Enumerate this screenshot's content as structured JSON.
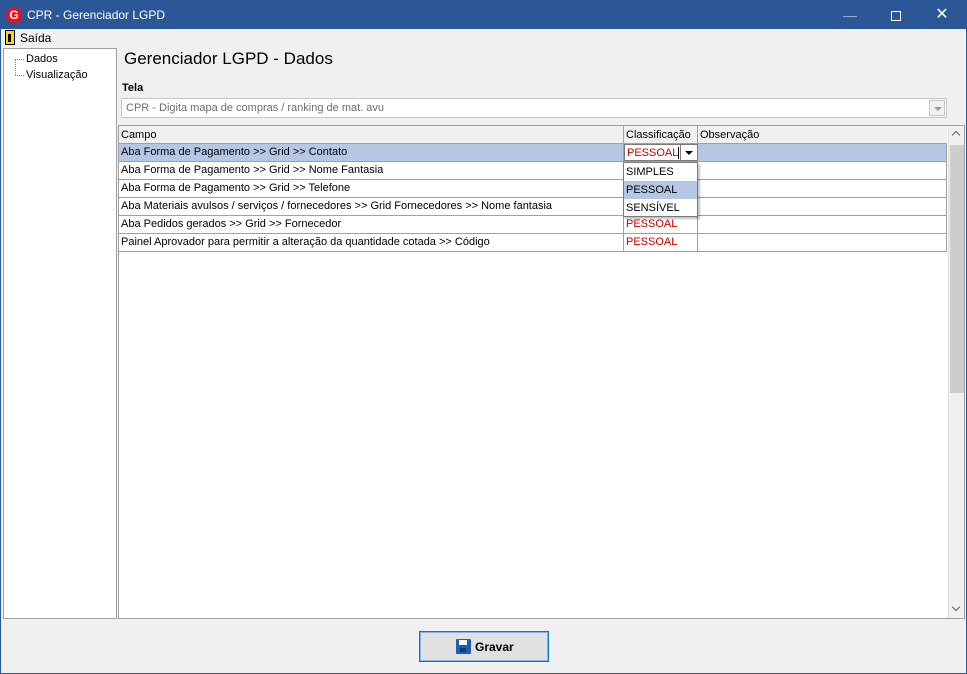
{
  "window": {
    "title": "CPR - Gerenciador LGPD",
    "app_icon_letter": "G"
  },
  "menu": {
    "exit_label": "Saída"
  },
  "tree": {
    "items": [
      "Dados",
      "Visualização"
    ]
  },
  "page": {
    "title": "Gerenciador LGPD - Dados",
    "tela_label": "Tela",
    "tela_value": "CPR - Digita mapa de compras / ranking de mat. avu"
  },
  "grid": {
    "columns": [
      "Campo",
      "Classificação",
      "Observação"
    ],
    "rows": [
      {
        "campo": "Aba Forma de Pagamento >> Grid >> Contato",
        "classificacao": "PESSOAL",
        "observacao": ""
      },
      {
        "campo": "Aba Forma de Pagamento >> Grid >> Nome Fantasia",
        "classificacao": "",
        "observacao": ""
      },
      {
        "campo": "Aba Forma de Pagamento >> Grid >> Telefone",
        "classificacao": "",
        "observacao": ""
      },
      {
        "campo": "Aba Materiais avulsos / serviços / fornecedores >> Grid Fornecedores >> Nome fantasia",
        "classificacao": "",
        "observacao": ""
      },
      {
        "campo": "Aba Pedidos gerados >> Grid >> Fornecedor",
        "classificacao": "PESSOAL",
        "observacao": ""
      },
      {
        "campo": "Painel Aprovador para permitir a alteração da quantidade cotada >> Código",
        "classificacao": "PESSOAL",
        "observacao": ""
      }
    ],
    "dropdown_options": [
      "SIMPLES",
      "PESSOAL",
      "SENSÍVEL"
    ],
    "dropdown_highlighted": "PESSOAL"
  },
  "footer": {
    "save_label": "Gravar"
  },
  "colors": {
    "titlebar": "#2b5797",
    "selection": "#b4c8e6",
    "pessoal_text": "#cc0000"
  }
}
